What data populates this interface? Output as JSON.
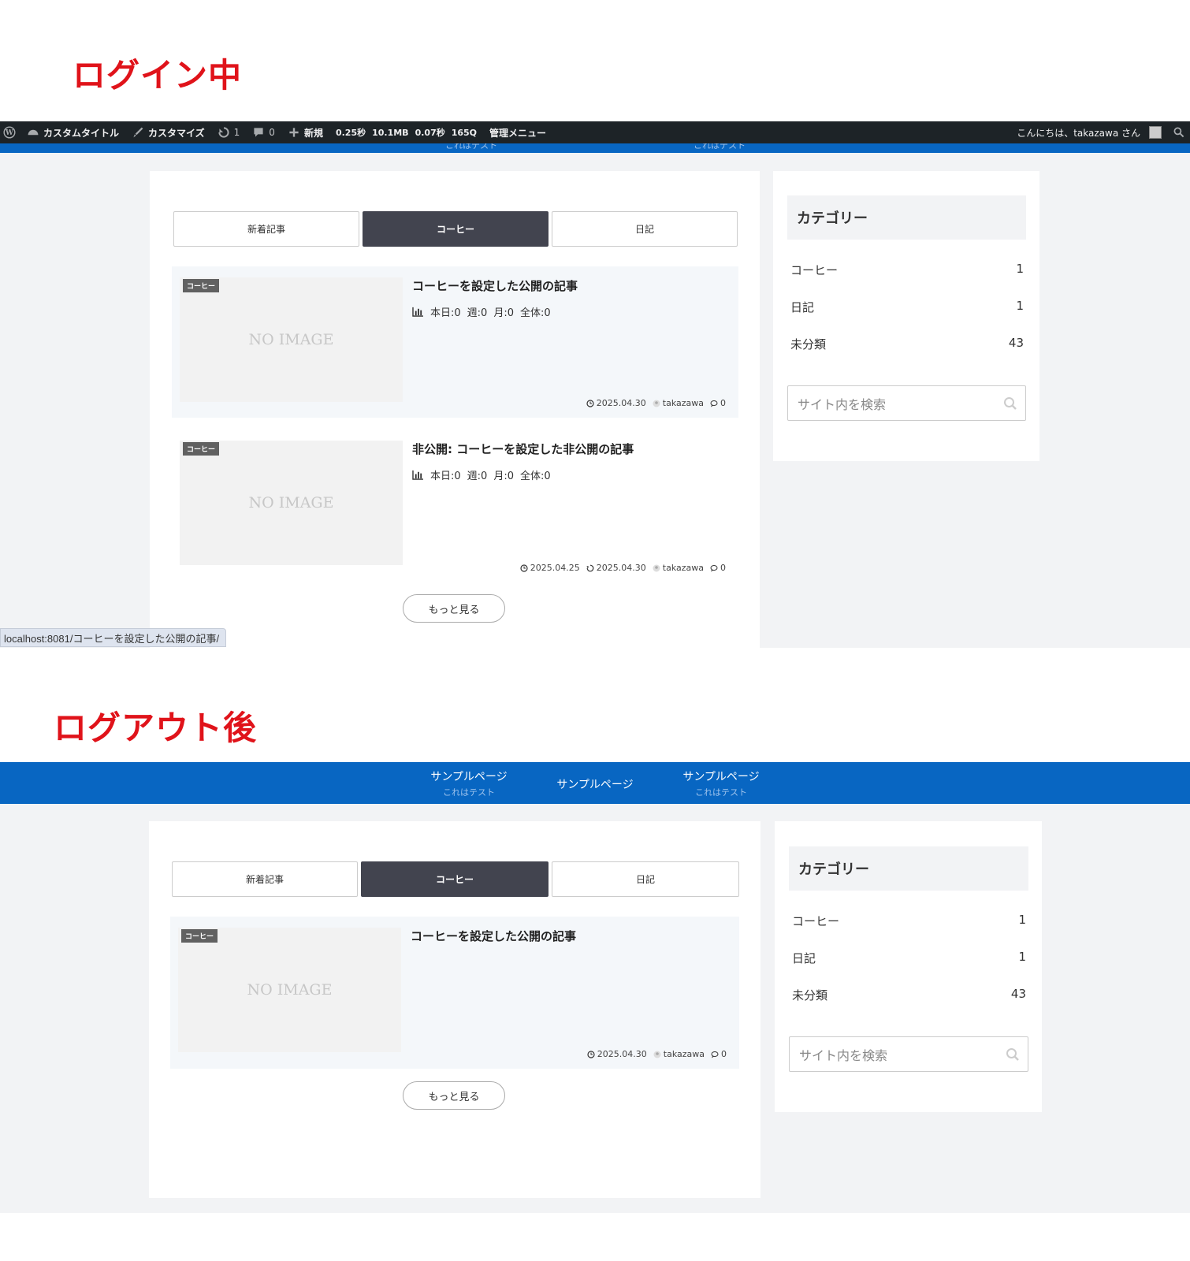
{
  "headings": {
    "logged_in": "ログイン中",
    "logged_out": "ログアウト後"
  },
  "admin_bar": {
    "site": "カスタムタイトル",
    "customize": "カスタマイズ",
    "updates": "1",
    "comments": "0",
    "new": "新規",
    "perf_time": "0.25秒",
    "perf_mem": "10.1MB",
    "perf_query_time": "0.07秒",
    "perf_queries": "165Q",
    "admin_menu": "管理メニュー",
    "greeting": "こんにちは、takazawa さん"
  },
  "nav": {
    "items": [
      {
        "label": "サンプルページ",
        "sub": "これはテスト"
      },
      {
        "label": "サンプルページ",
        "sub": ""
      },
      {
        "label": "サンプルページ",
        "sub": "これはテスト"
      }
    ]
  },
  "tabs": [
    {
      "label": "新着記事",
      "active": false
    },
    {
      "label": "コーヒー",
      "active": true
    },
    {
      "label": "日記",
      "active": false
    }
  ],
  "logged_in_posts": [
    {
      "badge": "コーヒー",
      "thumb": "NO IMAGE",
      "title": "コーヒーを設定した公開の記事",
      "stats": [
        "本日:0",
        "週:0",
        "月:0",
        "全体:0"
      ],
      "date": "2025.04.30",
      "updated": "",
      "author": "takazawa",
      "comments": "0"
    },
    {
      "badge": "コーヒー",
      "thumb": "NO IMAGE",
      "title": "非公開: コーヒーを設定した非公開の記事",
      "stats": [
        "本日:0",
        "週:0",
        "月:0",
        "全体:0"
      ],
      "date": "2025.04.25",
      "updated": "2025.04.30",
      "author": "takazawa",
      "comments": "0"
    }
  ],
  "logged_out_posts": [
    {
      "badge": "コーヒー",
      "thumb": "NO IMAGE",
      "title": "コーヒーを設定した公開の記事",
      "date": "2025.04.30",
      "author": "takazawa",
      "comments": "0"
    }
  ],
  "more_button": "もっと見る",
  "sidebar": {
    "title": "カテゴリー",
    "categories": [
      {
        "name": "コーヒー",
        "count": "1"
      },
      {
        "name": "日記",
        "count": "1"
      },
      {
        "name": "未分類",
        "count": "43"
      }
    ],
    "search_placeholder": "サイト内を検索"
  },
  "status_url": "localhost:8081/コーヒーを設定した公開の記事/",
  "colors": {
    "heading_red": "#e0131a",
    "nav_blue": "#0866c2",
    "admin_bar": "#1d2327",
    "tab_active": "#42444f"
  }
}
